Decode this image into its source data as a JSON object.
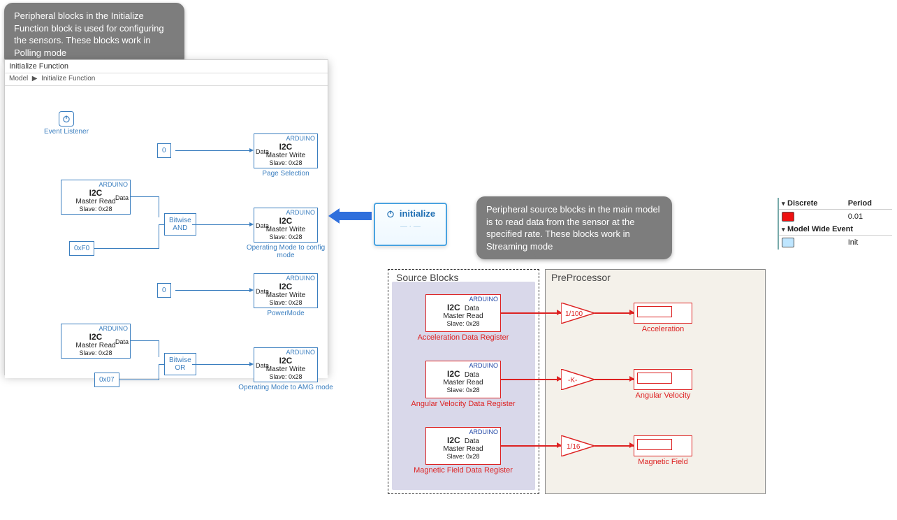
{
  "callouts": {
    "left": "Peripheral blocks in the Initialize Function block  is used for configuring the sensors. These blocks work in Polling mode",
    "right": "Peripheral source blocks in the main model is to read data from the sensor at the specified rate. These blocks work in Streaming mode"
  },
  "left_panel": {
    "title": "Initialize Function",
    "breadcrumb_a": "Model",
    "breadcrumb_b": "Initialize Function",
    "event_listener": "Event Listener",
    "const0": "0",
    "const0b": "0",
    "constF0": "0xF0",
    "const07": "0x07",
    "bit_and": "Bitwise\nAND",
    "bit_or": "Bitwise\nOR",
    "arduino": "ARDUINO",
    "i2c": "I2C",
    "mread": "Master Read",
    "mwrite": "Master Write",
    "slave": "Slave: 0x28",
    "port_data": "Data",
    "lbl_page": "Page Selection",
    "lbl_cfg": "Operating Mode to config mode",
    "lbl_power": "PowerMode",
    "lbl_amg": "Operating Mode to AMG mode"
  },
  "init_tile": {
    "label": "initialize"
  },
  "right": {
    "src_title": "Source Blocks",
    "pp_title": "PreProcessor",
    "arduino": "ARDUINO",
    "i2c": "I2C",
    "mread": "Master Read",
    "slave": "Slave: 0x28",
    "port_data": "Data",
    "lbl_accel_reg": "Acceleration Data Register",
    "lbl_angv_reg": "Angular Velocity Data Register",
    "lbl_mag_reg": "Magnetic Field Data Register",
    "gain1": "1/100",
    "gain2": "-K-",
    "gain3": "1/16",
    "disp_accel": "Acceleration",
    "disp_angv": "Angular Velocity",
    "disp_mag": "Magnetic Field"
  },
  "legend": {
    "hdr_discrete": "Discrete",
    "hdr_period": "Period",
    "val_period": "0.01",
    "hdr_event": "Model Wide Event",
    "val_event": "Init"
  }
}
